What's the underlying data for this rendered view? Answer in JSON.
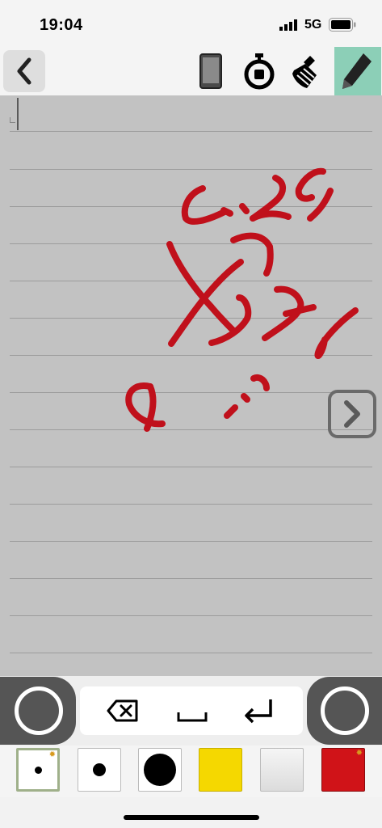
{
  "status": {
    "time": "19:04",
    "network": "5G"
  },
  "toolbar": {
    "back": "back",
    "tools": [
      "phone",
      "timer",
      "eraser-brush",
      "pen"
    ]
  },
  "palette": {
    "colors": {
      "accent": "#8ccfb7",
      "ink": "#c0101b",
      "yellow": "#f5d800",
      "red": "#d01318"
    }
  }
}
